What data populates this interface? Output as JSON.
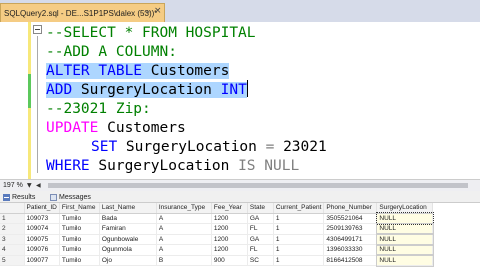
{
  "tab": {
    "title": "SQLQuery2.sql - DE...S1P1PS\\dalex (53))*",
    "pin_icon": "pin-icon",
    "close_label": "×"
  },
  "editor": {
    "lines": [
      {
        "parts": [
          "--SELECT * FROM HOSPITAL"
        ]
      },
      {
        "parts": [
          "--ADD A COLUMN:"
        ]
      },
      {
        "parts": [
          "ALTER",
          " ",
          "TABLE",
          " Customers"
        ]
      },
      {
        "parts": [
          "ADD",
          " SurgeryLocation ",
          "INT"
        ]
      },
      {
        "parts": [
          "--23021 Zip:"
        ]
      },
      {
        "parts": [
          "UPDATE",
          " Customers"
        ]
      },
      {
        "parts": [
          "SET",
          " SurgeryLocation ",
          "=",
          " 23021"
        ]
      },
      {
        "parts": [
          "WHERE",
          " SurgeryLocation ",
          "IS",
          " ",
          "NULL"
        ]
      }
    ]
  },
  "zoom": {
    "level": "197 %"
  },
  "results_tabs": {
    "results_label": "Results",
    "messages_label": "Messages"
  },
  "grid": {
    "columns": [
      "",
      "Patient_ID",
      "First_Name",
      "Last_Name",
      "Insurance_Type",
      "Fee_Year",
      "State",
      "Current_Patient",
      "Phone_Number",
      "SurgeryLocation"
    ],
    "rows": [
      [
        "1",
        "109073",
        "Tumilo",
        "Bada",
        "A",
        "1200",
        "GA",
        "1",
        "3505521064",
        "NULL"
      ],
      [
        "2",
        "109074",
        "Tumilo",
        "Famiran",
        "A",
        "1200",
        "FL",
        "1",
        "2509139763",
        "NULL"
      ],
      [
        "3",
        "109075",
        "Tumilo",
        "Ogunbowale",
        "A",
        "1200",
        "GA",
        "1",
        "4306499171",
        "NULL"
      ],
      [
        "4",
        "109076",
        "Tumilo",
        "Ogunmola",
        "A",
        "1200",
        "FL",
        "1",
        "1396033330",
        "NULL"
      ],
      [
        "5",
        "109077",
        "Tumilo",
        "Ojo",
        "B",
        "900",
        "SC",
        "1",
        "8166412508",
        "NULL"
      ]
    ]
  },
  "colors": {
    "comment": "#008000",
    "keyword": "#0000ff",
    "operator": "#808080",
    "function": "#ff00ff",
    "selection": "#add6ff",
    "tab": "#f5cc84"
  }
}
